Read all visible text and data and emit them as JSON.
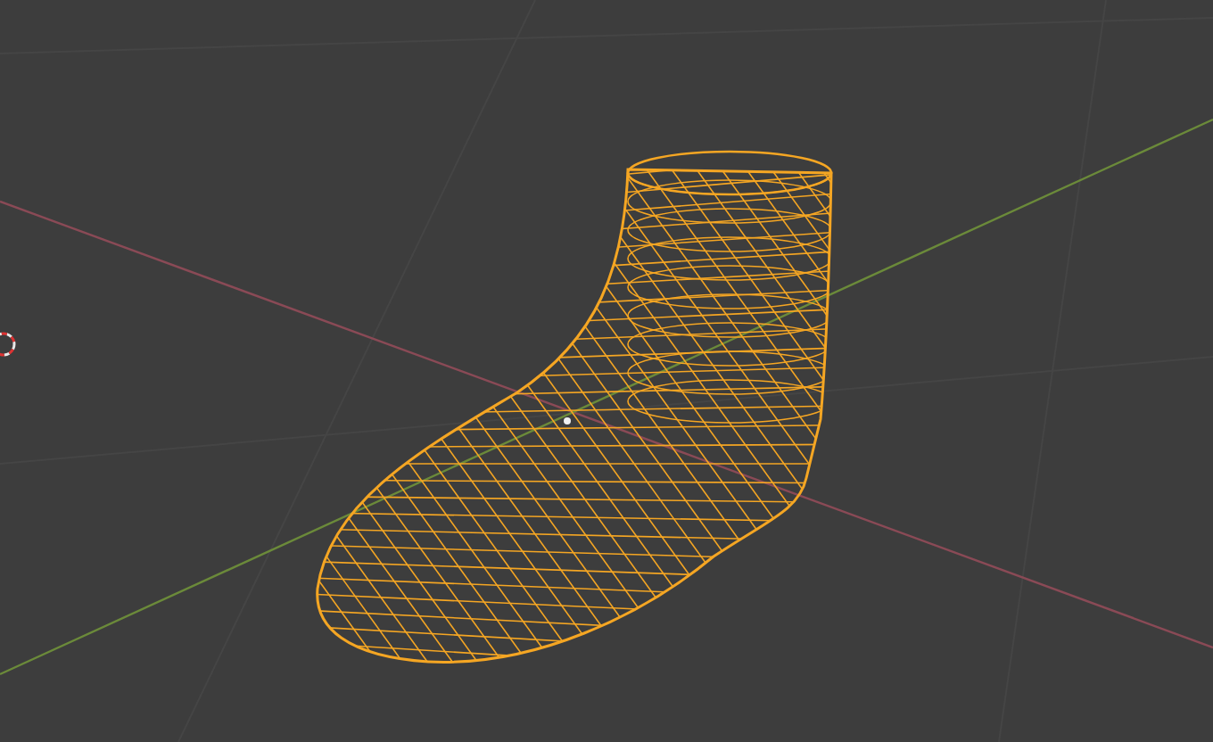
{
  "viewport": {
    "object_selected": true,
    "show_axes": true
  }
}
